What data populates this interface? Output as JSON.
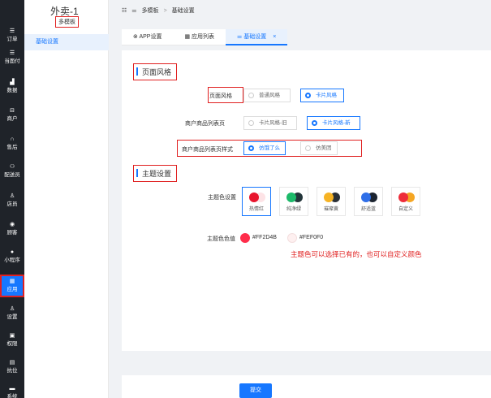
{
  "nav": [
    {
      "icon": "☰",
      "label": "订单"
    },
    {
      "icon": "☰",
      "label": "当面付"
    },
    {
      "icon": "▟",
      "label": "数据"
    },
    {
      "icon": "⊟",
      "label": "商户"
    },
    {
      "icon": "∩",
      "label": "售后"
    },
    {
      "icon": "⚇",
      "label": "配送员"
    },
    {
      "icon": "♙",
      "label": "店员"
    },
    {
      "icon": "◉",
      "label": "顾客"
    },
    {
      "icon": "●",
      "label": "小程序"
    },
    {
      "icon": "▦",
      "label": "应用"
    },
    {
      "icon": "♙",
      "label": "设置"
    },
    {
      "icon": "▣",
      "label": "权限"
    },
    {
      "icon": "▤",
      "label": "抗位"
    },
    {
      "icon": "▬",
      "label": "系统"
    }
  ],
  "sidebar": {
    "title": "外卖-1",
    "badge": "多模板",
    "menu": "基础设置"
  },
  "breadcrumb": {
    "icon": "☷",
    "first": "多模板",
    "sep": ">",
    "second": "基础设置"
  },
  "tabs": [
    {
      "label": "APP设置"
    },
    {
      "label": "应用列表"
    },
    {
      "label": "基础设置",
      "close": "×"
    }
  ],
  "page_style": {
    "section_title": "页面风格",
    "style_label": "页面风格",
    "style_options": [
      "普通风格",
      "卡片风格"
    ],
    "style_selected": 1,
    "goods_page_label": "商户商品列表页",
    "goods_page_options": [
      "卡片风格-旧",
      "卡片风格-新"
    ],
    "goods_page_selected": 1,
    "goods_style_label": "商户商品列表页样式",
    "goods_style_options": [
      "仿饿了么",
      "仿美团"
    ],
    "goods_style_selected": 0
  },
  "theme": {
    "section_title": "主题设置",
    "theme_label": "主题色设置",
    "themes": [
      {
        "name": "热情红",
        "c1": "#e8152d",
        "c2": "#fde3e6"
      },
      {
        "name": "纯净绿",
        "c1": "#1dba6a",
        "c2": "#23353a"
      },
      {
        "name": "璀璨黄",
        "c1": "#f6b324",
        "c2": "#2a3037"
      },
      {
        "name": "舒适蓝",
        "c1": "#2f6fe8",
        "c2": "#1c2430"
      },
      {
        "name": "自定义",
        "c1": "#ee2d3a",
        "c2": "#f5a623"
      }
    ],
    "theme_selected": 0,
    "color_label": "主题色色值",
    "color1": "#FF2D4B",
    "color2": "#FEF0F0",
    "note": "主题色可以选择已有的，也可以自定义颜色"
  },
  "footer": {
    "submit": "提交"
  }
}
